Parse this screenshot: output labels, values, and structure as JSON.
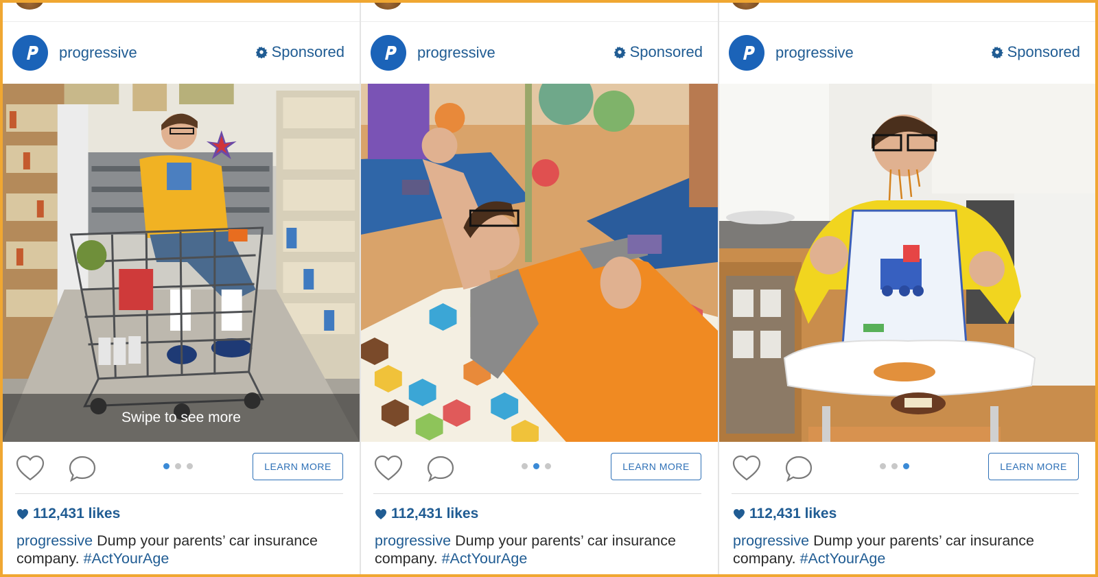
{
  "brand": {
    "username": "progressive",
    "sponsored_label": "Sponsored",
    "logo_letter": "P",
    "color": "#1b63b8"
  },
  "posts": [
    {
      "swipe_hint": "Swipe to see more",
      "cta_label": "LEARN MORE",
      "likes": "112,431 likes",
      "caption_user": "progressive",
      "caption_text": " Dump your parents’ car insurance company. ",
      "caption_tag": "#ActYourAge",
      "active_dot": 1,
      "dot_count": 3
    },
    {
      "cta_label": "LEARN MORE",
      "likes": "112,431 likes",
      "caption_user": "progressive",
      "caption_text": " Dump your parents’ car insurance company. ",
      "caption_tag": "#ActYourAge",
      "active_dot": 2,
      "dot_count": 3
    },
    {
      "cta_label": "LEARN MORE",
      "likes": "112,431 likes",
      "caption_user": "progressive",
      "caption_text": " Dump your parents’ car insurance company. ",
      "caption_tag": "#ActYourAge",
      "active_dot": 3,
      "dot_count": 3
    }
  ],
  "icons": {
    "heart": "heart-icon",
    "comment": "comment-icon",
    "gear": "gear-icon"
  },
  "colors": {
    "link_blue": "#205c93",
    "accent_blue": "#3b8ad6",
    "frame_orange": "#f0a732"
  }
}
